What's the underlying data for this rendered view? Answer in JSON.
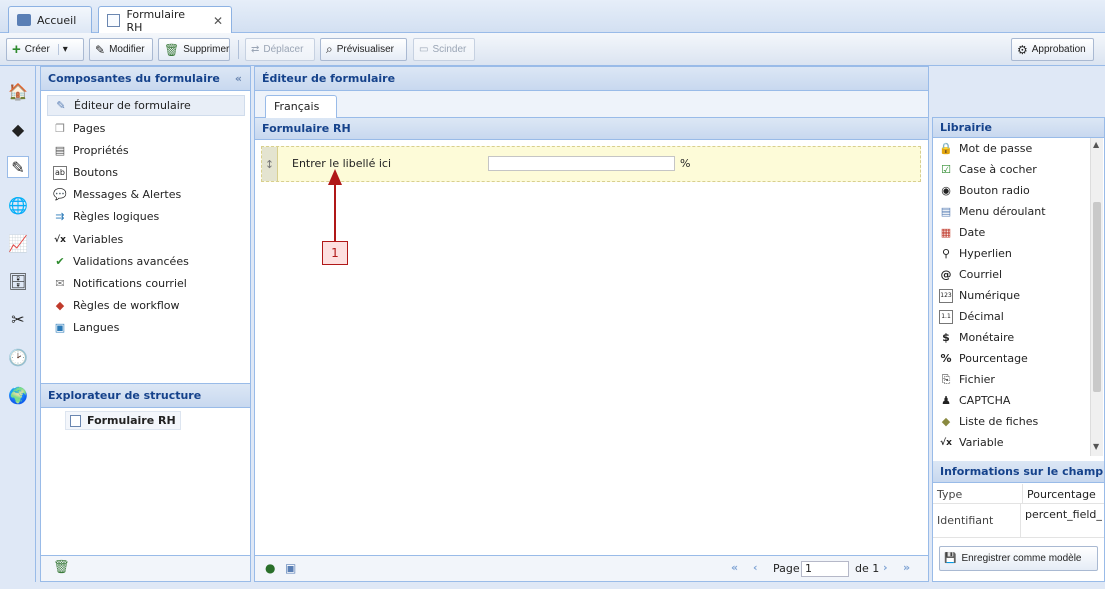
{
  "tabs": [
    {
      "label": "Accueil",
      "icon": "home-icon"
    },
    {
      "label": "Formulaire RH",
      "icon": "form-icon",
      "close": "✕"
    }
  ],
  "toolbar": {
    "create": "Créer",
    "modify": "Modifier",
    "delete": "Supprimer",
    "move": "Déplacer",
    "preview": "Prévisualiser",
    "split": "Scinder",
    "approval": "Approbation"
  },
  "left_panel": {
    "title": "Composantes du formulaire",
    "collapse": "«",
    "items": [
      {
        "label": "Éditeur de formulaire",
        "icon": "✎"
      },
      {
        "label": "Pages",
        "icon": "❐"
      },
      {
        "label": "Propriétés",
        "icon": "▤"
      },
      {
        "label": "Boutons",
        "icon": "ab"
      },
      {
        "label": "Messages & Alertes",
        "icon": "💬"
      },
      {
        "label": "Règles logiques",
        "icon": "⇉"
      },
      {
        "label": "Variables",
        "icon": "√x"
      },
      {
        "label": "Validations avancées",
        "icon": "✔"
      },
      {
        "label": "Notifications courriel",
        "icon": "✉"
      },
      {
        "label": "Règles de workflow",
        "icon": "◆"
      },
      {
        "label": "Langues",
        "icon": "▣"
      }
    ]
  },
  "structure": {
    "title": "Explorateur de structure",
    "node": "Formulaire RH"
  },
  "editor": {
    "title": "Éditeur de formulaire",
    "lang_tab": "Français",
    "form_title": "Formulaire RH",
    "field_label": "Entrer le libellé ici",
    "field_suffix": "%",
    "annotation_number": "1"
  },
  "pager": {
    "page_label": "Page",
    "page_value": "1",
    "of_label": "de 1"
  },
  "library": {
    "title": "Librairie",
    "items": [
      {
        "label": "Mot de passe",
        "icon": "🔒"
      },
      {
        "label": "Case à cocher",
        "icon": "☑"
      },
      {
        "label": "Bouton radio",
        "icon": "◉"
      },
      {
        "label": "Menu déroulant",
        "icon": "▤"
      },
      {
        "label": "Date",
        "icon": "▦"
      },
      {
        "label": "Hyperlien",
        "icon": "⚲"
      },
      {
        "label": "Courriel",
        "icon": "@"
      },
      {
        "label": "Numérique",
        "icon": "123"
      },
      {
        "label": "Décimal",
        "icon": "1.1"
      },
      {
        "label": "Monétaire",
        "icon": "$"
      },
      {
        "label": "Pourcentage",
        "icon": "%"
      },
      {
        "label": "Fichier",
        "icon": "⎘"
      },
      {
        "label": "CAPTCHA",
        "icon": "♟"
      },
      {
        "label": "Liste de fiches",
        "icon": "◆"
      },
      {
        "label": "Variable",
        "icon": "√x"
      }
    ]
  },
  "field_info": {
    "title": "Informations sur le champ",
    "rows": [
      {
        "key": "Type",
        "value": "Pourcentage"
      },
      {
        "key": "Identifiant",
        "value": "percent_field_"
      }
    ],
    "save_template": "Enregistrer comme modèle"
  },
  "colors": {
    "accent": "#15428b",
    "field_bg": "#fdfbd8",
    "arrow": "#b01818"
  }
}
